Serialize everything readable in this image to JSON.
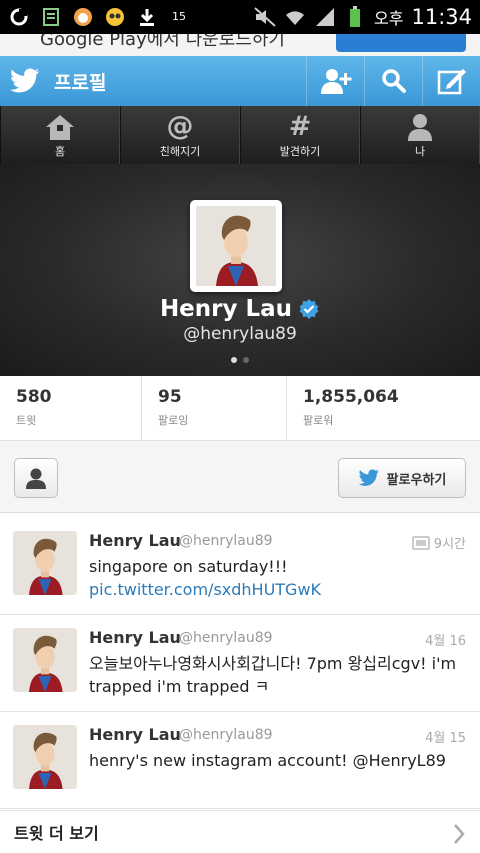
{
  "status_bar": {
    "ampm": "오후",
    "time": "11:34",
    "badge": "15"
  },
  "banner": {
    "text": "Google Play에서 다운로드하기"
  },
  "action_bar": {
    "title": "프로필"
  },
  "tabs": [
    {
      "label": "홈",
      "icon": "home-icon"
    },
    {
      "label": "친해지기",
      "icon": "at-icon"
    },
    {
      "label": "발견하기",
      "icon": "hash-icon"
    },
    {
      "label": "나",
      "icon": "person-icon"
    }
  ],
  "profile": {
    "name": "Henry Lau",
    "handle": "@henrylau89",
    "verified": true
  },
  "stats": [
    {
      "value": "580",
      "label": "트윗"
    },
    {
      "value": "95",
      "label": "팔로잉"
    },
    {
      "value": "1,855,064",
      "label": "팔로워"
    }
  ],
  "follow": {
    "label": "팔로우하기"
  },
  "tweets": [
    {
      "name": "Henry Lau",
      "handle": "@henrylau89",
      "time": "9시간",
      "has_media": true,
      "text": "singapore on saturday!!! ",
      "link": "pic.twitter.com/sxdhHUTGwK"
    },
    {
      "name": "Henry Lau",
      "handle": "@henrylau89",
      "time": "4월 16",
      "text": "오늘보아누나영화시사회갑니다! 7pm 왕십리cgv! i'm trapped i'm trapped ㅋ",
      "link": ""
    },
    {
      "name": "Henry Lau",
      "handle": "@henrylau89",
      "time": "4월 15",
      "text": "henry's new instagram account! @HenryL89",
      "link": ""
    }
  ],
  "more": {
    "label": "트윗 더 보기"
  },
  "colors": {
    "twitter_blue": "#3a98d6",
    "link": "#2b7bb9",
    "verified": "#3ea2e4"
  }
}
